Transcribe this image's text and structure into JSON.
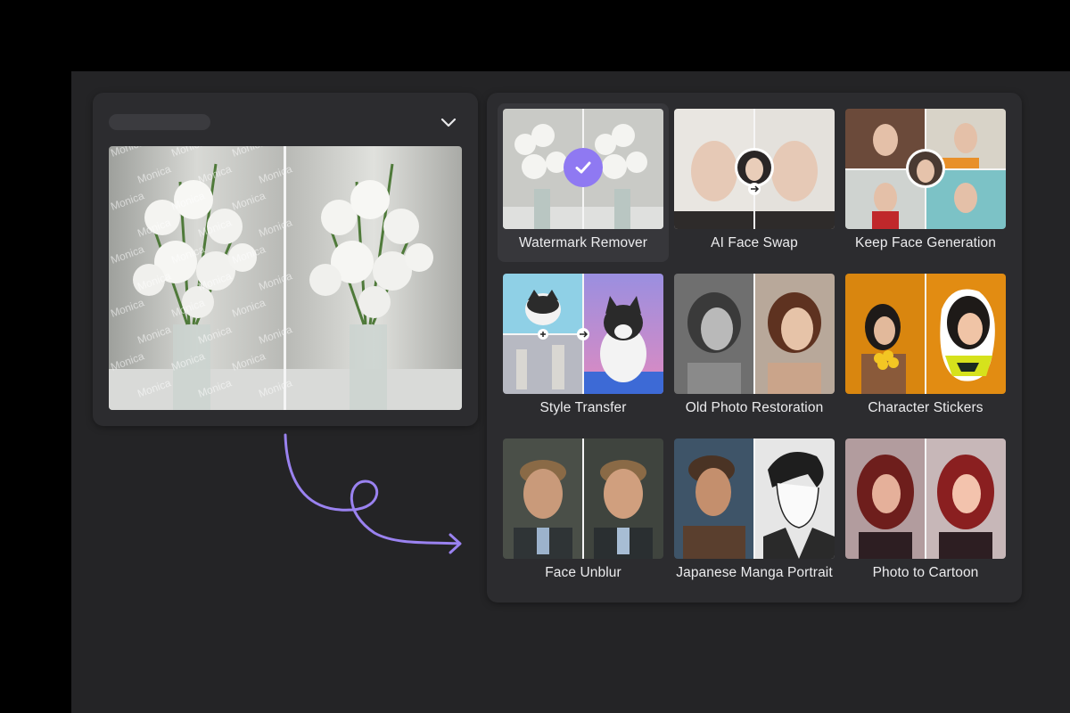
{
  "app": {
    "accent_color": "#8f79f2"
  },
  "preview": {
    "title": "",
    "collapse_icon": "chevron-down-icon",
    "watermark_text": "Monica",
    "compare_divider": true
  },
  "tools": [
    {
      "label": "Watermark Remover",
      "selected": true,
      "icon": "check-icon"
    },
    {
      "label": "AI Face Swap",
      "selected": false
    },
    {
      "label": "Keep Face Generation",
      "selected": false
    },
    {
      "label": "Style Transfer",
      "selected": false
    },
    {
      "label": "Old Photo Restoration",
      "selected": false
    },
    {
      "label": "Character Stickers",
      "selected": false
    },
    {
      "label": "Face Unblur",
      "selected": false
    },
    {
      "label": "Japanese Manga Portrait",
      "selected": false
    },
    {
      "label": "Photo to Cartoon",
      "selected": false
    }
  ],
  "connector": {
    "icon": "curved-arrow-icon",
    "color": "#9a82f0"
  }
}
